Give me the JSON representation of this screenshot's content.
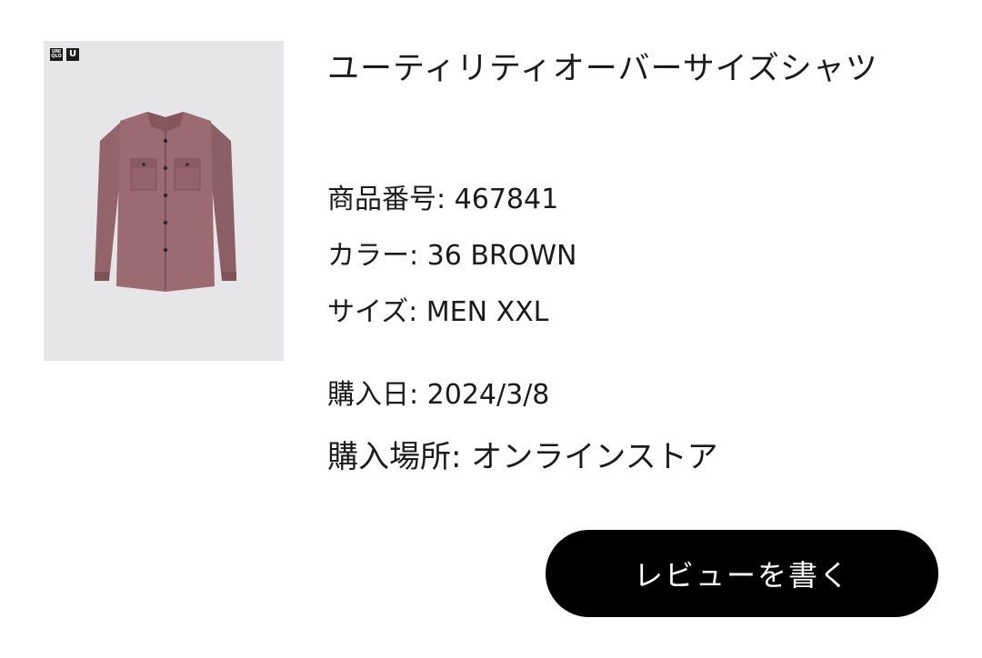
{
  "product": {
    "title": "ユーティリティオーバーサイズシャツ",
    "logos": [
      "UNI QLO",
      "U"
    ]
  },
  "details": {
    "code_label": "商品番号:",
    "code_value": " 467841",
    "color_label": "カラー:",
    "color_value": " 36 BROWN",
    "size_label": "サイズ:",
    "size_value": " MEN XXL",
    "date_label": "購入日:",
    "date_value": " 2024/3/8",
    "place_label": "購入場所:",
    "place_value": " オンラインストア"
  },
  "actions": {
    "review_label": "レビューを書く"
  },
  "colors": {
    "shirt": "#9c6b72",
    "image_bg": "#e6e6e9",
    "button_bg": "#000000"
  }
}
